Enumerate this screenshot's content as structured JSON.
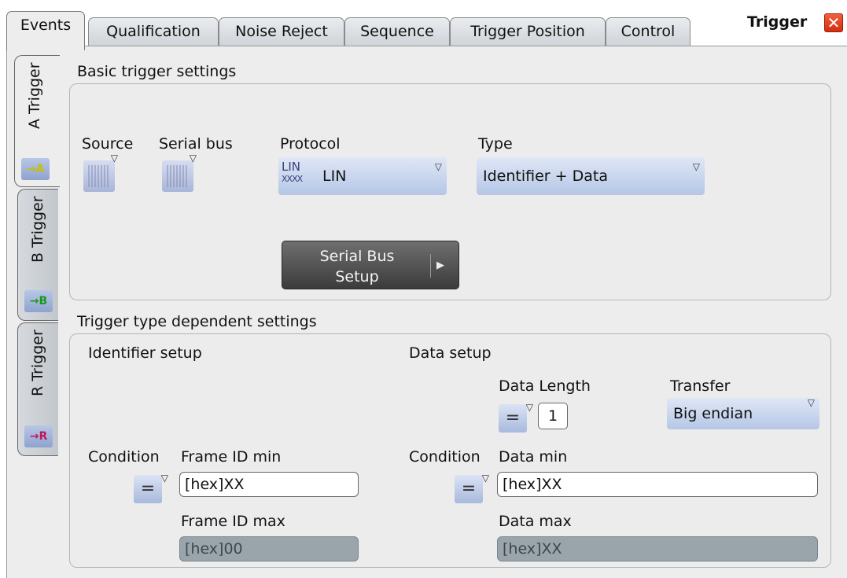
{
  "tabs": [
    "Events",
    "Qualification",
    "Noise Reject",
    "Sequence",
    "Trigger Position",
    "Control"
  ],
  "window_title": "Trigger",
  "close_glyph": "✕",
  "side_tabs": [
    {
      "label": "A Trigger",
      "icon": "→A"
    },
    {
      "label": "B Trigger",
      "icon": "→B"
    },
    {
      "label": "R Trigger",
      "icon": "→R"
    }
  ],
  "basic": {
    "title": "Basic trigger settings",
    "source_label": "Source",
    "serial_bus_label": "Serial bus",
    "protocol_label": "Protocol",
    "protocol_value": "LIN",
    "protocol_icon_text": "LIN",
    "type_label": "Type",
    "type_value": "Identifier + Data",
    "setup_button_line1": "Serial Bus",
    "setup_button_line2": "Setup"
  },
  "dependent": {
    "title": "Trigger type dependent settings",
    "identifier_setup": "Identifier setup",
    "data_setup": "Data setup",
    "data_length_label": "Data Length",
    "data_length_value": "1",
    "transfer_label": "Transfer",
    "transfer_value": "Big endian",
    "condition_label_1": "Condition",
    "frame_id_min_label": "Frame ID min",
    "frame_id_min_value": "[hex]XX",
    "frame_id_max_label": "Frame ID max",
    "frame_id_max_value": "[hex]00",
    "condition_label_2": "Condition",
    "data_min_label": "Data min",
    "data_min_value": "[hex]XX",
    "data_max_label": "Data max",
    "data_max_value": "[hex]XX",
    "eq_symbol": "="
  },
  "colors": {
    "dropdown": "#b5c7e6",
    "setup_button": "#3b3b3b",
    "close": "#d42d10",
    "disabled_field": "#9aa4ab"
  }
}
